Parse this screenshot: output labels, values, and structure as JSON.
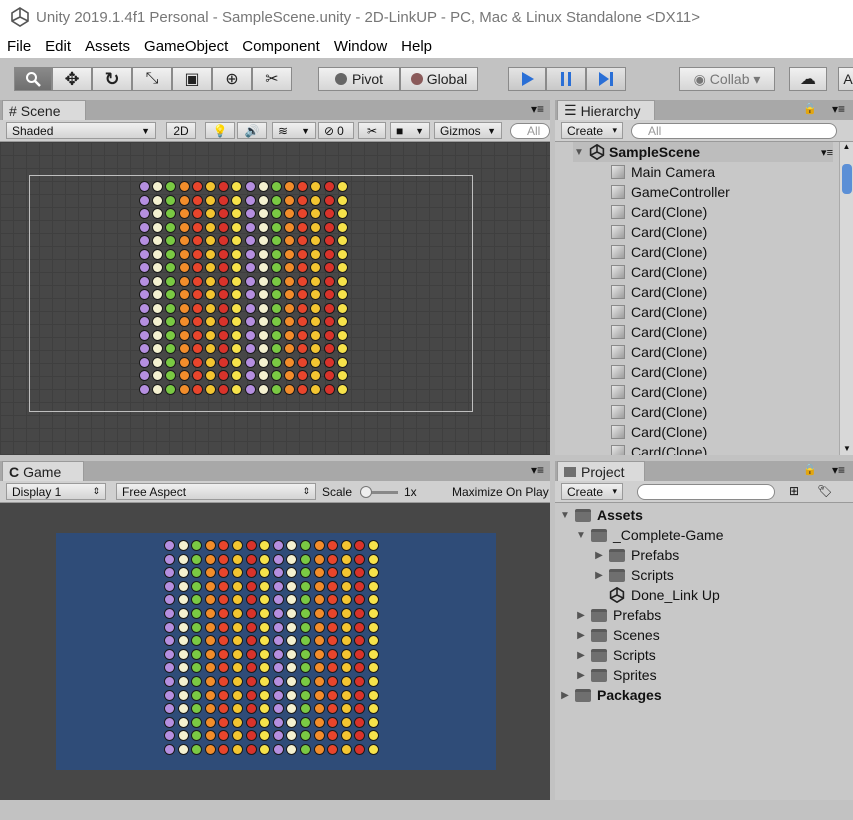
{
  "window": {
    "title": "Unity 2019.1.4f1 Personal - SampleScene.unity - 2D-LinkUP - PC, Mac & Linux Standalone <DX11>"
  },
  "menu": [
    "File",
    "Edit",
    "Assets",
    "GameObject",
    "Component",
    "Window",
    "Help"
  ],
  "toolbar": {
    "pivot": "Pivot",
    "global": "Global",
    "collab": "Collab ▾",
    "account": "A"
  },
  "scene": {
    "tab": "Scene",
    "shading": "Shaded",
    "mode2d": "2D",
    "hidden_count": "0",
    "gizmos": "Gizmos",
    "search_placeholder": "All"
  },
  "game": {
    "tab": "Game",
    "display": "Display 1",
    "aspect": "Free Aspect",
    "scale_label": "Scale",
    "scale_value": "1x",
    "maximize": "Maximize On Play"
  },
  "hierarchy": {
    "tab": "Hierarchy",
    "create": "Create",
    "search_placeholder": "All",
    "scene": "SampleScene",
    "items": [
      "Main Camera",
      "GameController",
      "Card(Clone)",
      "Card(Clone)",
      "Card(Clone)",
      "Card(Clone)",
      "Card(Clone)",
      "Card(Clone)",
      "Card(Clone)",
      "Card(Clone)",
      "Card(Clone)",
      "Card(Clone)",
      "Card(Clone)",
      "Card(Clone)",
      "Card(Clone)"
    ]
  },
  "project": {
    "tab": "Project",
    "create": "Create",
    "assets": "Assets",
    "complete_game": "_Complete-Game",
    "cg_prefabs": "Prefabs",
    "cg_scripts": "Scripts",
    "cg_scene": "Done_Link Up",
    "prefabs": "Prefabs",
    "scenes": "Scenes",
    "scripts": "Scripts",
    "sprites": "Sprites",
    "packages": "Packages"
  },
  "colors": {
    "game_bg": "#2f4c78",
    "play_blue": "#2a6fd6",
    "tile_palette": [
      "#e8452c",
      "#f3c531",
      "#7ac943",
      "#f28d2b",
      "#b58fe0",
      "#f4f1d0",
      "#d9332b",
      "#f6e24a"
    ]
  }
}
